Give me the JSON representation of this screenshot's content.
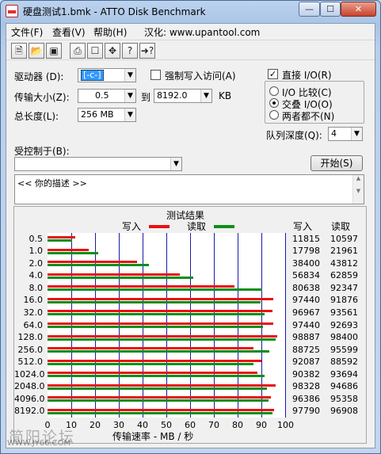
{
  "window": {
    "title": "硬盘测试1.bmk - ATTO Disk Benchmark",
    "minimize_glyph": "—",
    "maximize_glyph": "☐",
    "close_glyph": "✕"
  },
  "menu": {
    "file": "文件(F)",
    "view": "查看(V)",
    "help": "帮助(H)",
    "localized": "汉化: www.upantool.com"
  },
  "toolbar": {
    "icons": [
      "new-file-icon",
      "open-folder-icon",
      "save-icon",
      "print-icon",
      "print-preview-icon",
      "move-icon",
      "help-icon",
      "context-help-icon"
    ]
  },
  "settings": {
    "drive_label": "驱动器 (D):",
    "drive_value": "[-c-]",
    "force_write_label": "强制写入访问(A)",
    "force_write_checked": false,
    "transfer_size_label": "传输大小(Z):",
    "transfer_from": "0.5",
    "to_label": "到",
    "transfer_to": "8192.0",
    "kb_unit": "KB",
    "total_length_label": "总长度(L):",
    "total_length_value": "256 MB",
    "direct_io_label": "直接 I/O(R)",
    "direct_io_checked": true,
    "io_compare_label": "I/O 比较(C)",
    "overlapped_io_label": "交叠 I/O(O)",
    "neither_label": "两者都不(N)",
    "selected_io_mode": "overlapped",
    "queue_depth_label": "队列深度(Q):",
    "queue_depth_value": "4",
    "controlled_by_label": "受控制于(B):",
    "controlled_by_value": "",
    "start_button": "开始(S)",
    "description": "<<  你的描述   >>"
  },
  "results": {
    "group_title": "测试结果",
    "legend_write": "写入",
    "legend_read": "读取",
    "col_write": "写入",
    "col_read": "读取",
    "xlabel": "传输速率 - MB / 秒",
    "colors": {
      "write": "#e81010",
      "read": "#0b8f1a",
      "grid": "#1a1aa8"
    }
  },
  "chart_data": {
    "type": "bar",
    "orientation": "horizontal",
    "xlabel": "传输速率 - MB / 秒",
    "xlim": [
      0,
      100
    ],
    "xticks": [
      "0",
      "10",
      "20",
      "30",
      "40",
      "50",
      "60",
      "70",
      "80",
      "90",
      "100"
    ],
    "categories": [
      "0.5",
      "1.0",
      "2.0",
      "4.0",
      "8.0",
      "16.0",
      "32.0",
      "64.0",
      "128.0",
      "256.0",
      "512.0",
      "1024.0",
      "2048.0",
      "4096.0",
      "8192.0"
    ],
    "series": [
      {
        "name": "写入",
        "values_kb": [
          11815,
          17798,
          38400,
          56834,
          80638,
          97440,
          96967,
          97440,
          98887,
          88725,
          92087,
          90382,
          98328,
          96386,
          97790
        ]
      },
      {
        "name": "读取",
        "values_kb": [
          10597,
          21961,
          43812,
          62859,
          92347,
          91876,
          93561,
          92693,
          98400,
          95599,
          88592,
          93694,
          94686,
          95358,
          96908
        ]
      }
    ],
    "grid": true,
    "legend_position": "top"
  },
  "watermark": {
    "text": "简阳论坛",
    "url": "WWW.JY66.COM"
  }
}
